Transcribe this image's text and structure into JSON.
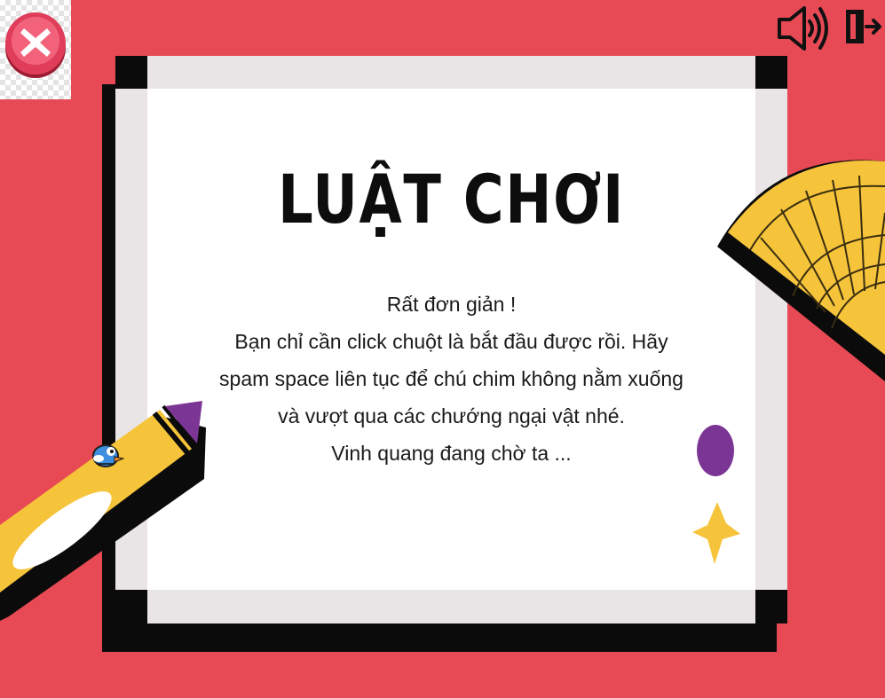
{
  "title": "LUẬT CHƠI",
  "rules": [
    "Rất đơn giản !",
    "Bạn chỉ cần click chuột là bắt đầu được rồi. Hãy",
    "spam space liên tục để chú chim không nằm xuống",
    "và vượt qua các chướng ngại vật nhé.",
    "Vinh quang đang chờ ta ..."
  ],
  "icons": {
    "close": "close-x-icon",
    "sound": "speaker-sound-icon",
    "exit": "exit-door-icon"
  },
  "colors": {
    "background": "#e84a55",
    "board": "#ffffff",
    "border": "#0b0b0b",
    "accent_yellow": "#f6c43a",
    "accent_purple": "#7b3594"
  }
}
